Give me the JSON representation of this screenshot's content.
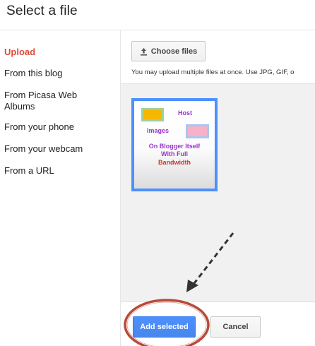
{
  "dialog": {
    "title": "Select a file"
  },
  "sidebar": {
    "items": [
      {
        "label": "Upload",
        "active": true
      },
      {
        "label": "From this blog",
        "active": false
      },
      {
        "label": "From Picasa Web Albums",
        "active": false
      },
      {
        "label": "From your phone",
        "active": false
      },
      {
        "label": "From your webcam",
        "active": false
      },
      {
        "label": "From a URL",
        "active": false
      }
    ]
  },
  "upload": {
    "choose_label": "Choose files",
    "choose_icon": "upload-icon",
    "hint": "You may upload multiple files at once. Use JPG, GIF, o"
  },
  "thumbnail": {
    "selected": true,
    "text": {
      "host": "Host",
      "images": "Images",
      "line1": "On Blogger Itself",
      "line2": "With Full",
      "line3": "Bandwidth"
    }
  },
  "footer": {
    "add_label": "Add selected",
    "cancel_label": "Cancel"
  },
  "colors": {
    "active_nav": "#dd4b39",
    "primary_button": "#4d90fe",
    "selection_border": "#4d90fe",
    "annotation_circle": "#b84a3a",
    "annotation_arrow": "#333333"
  }
}
